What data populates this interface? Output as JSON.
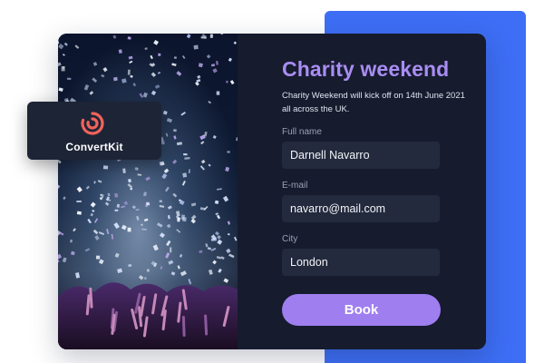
{
  "brand": {
    "name": "ConvertKit",
    "logo_icon": "convertkit-logo-icon",
    "logo_color": "#f0635b"
  },
  "hero_image": {
    "icon": "confetti-concert-photo"
  },
  "event": {
    "title": "Charity weekend",
    "description": "Charity Weekend will kick off on 14th June 2021 all across the UK."
  },
  "form": {
    "fields": [
      {
        "label": "Full name",
        "value": "Darnell Navarro"
      },
      {
        "label": "E-mail",
        "value": "navarro@mail.com"
      },
      {
        "label": "City",
        "value": "London"
      }
    ],
    "submit_label": "Book"
  },
  "colors": {
    "accent_panel": "#3d6ef5",
    "card_background": "#161b2e",
    "title": "#a98df2",
    "button": "#9f7ef0",
    "field_background": "#242a3d"
  }
}
